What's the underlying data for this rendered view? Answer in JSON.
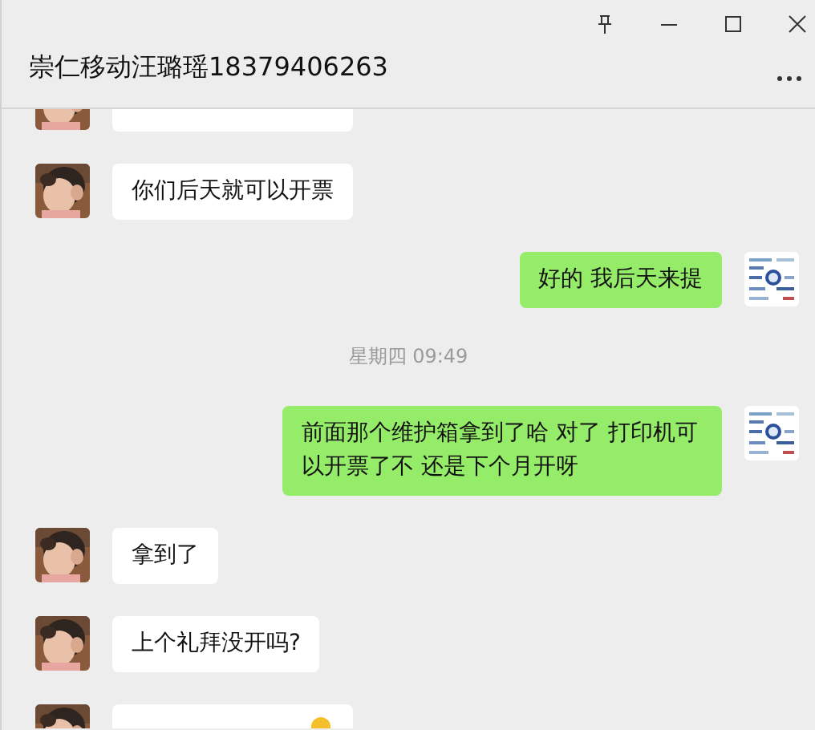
{
  "window": {
    "title": "崇仁移动汪璐瑶18379406263"
  },
  "messages": [
    {
      "kind": "incoming"
    },
    {
      "kind": "incoming",
      "text": "你们后天就可以开票"
    },
    {
      "kind": "outgoing",
      "text": "好的 我后天来提"
    },
    {
      "kind": "time",
      "text": "星期四 09:49"
    },
    {
      "kind": "outgoing",
      "text": "前面那个维护箱拿到了哈  对了 打印机可以开票了不  还是下个月开呀"
    },
    {
      "kind": "incoming",
      "text": "拿到了"
    },
    {
      "kind": "incoming",
      "text": "上个礼拜没开吗?"
    },
    {
      "kind": "incoming",
      "emoji": true
    }
  ]
}
